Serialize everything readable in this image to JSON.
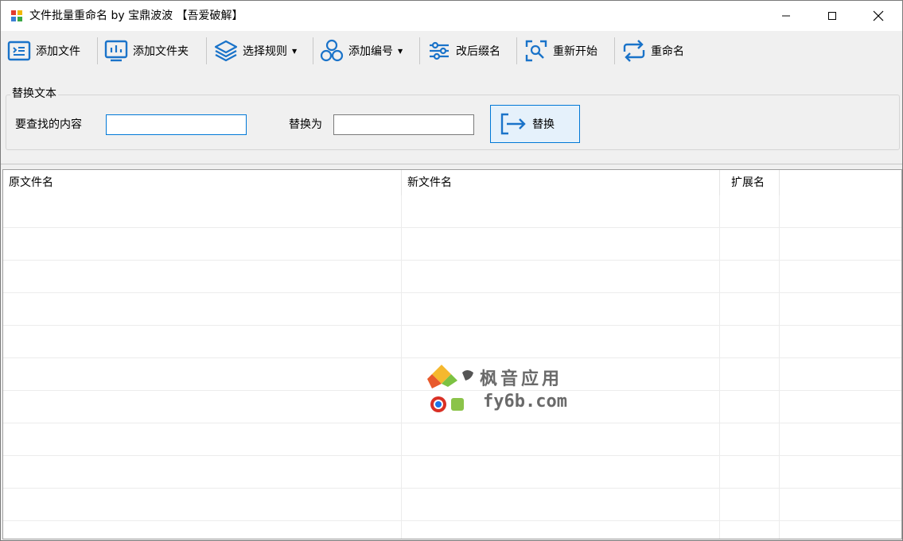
{
  "window": {
    "title": "文件批量重命名 by 宝鼎波波 【吾爱破解】"
  },
  "toolbar": {
    "items": [
      {
        "label": "添加文件",
        "icon": "add-file-icon"
      },
      {
        "label": "添加文件夹",
        "icon": "add-folder-icon"
      },
      {
        "label": "选择规则",
        "icon": "layers-icon",
        "dropdown": true
      },
      {
        "label": "添加编号",
        "icon": "hexagons-icon",
        "dropdown": true
      },
      {
        "label": "改后缀名",
        "icon": "sliders-icon"
      },
      {
        "label": "重新开始",
        "icon": "search-frame-icon"
      },
      {
        "label": "重命名",
        "icon": "repeat-icon"
      }
    ]
  },
  "replace_group": {
    "title": "替换文本",
    "find_label": "要查找的内容",
    "find_value": "",
    "replace_label": "替换为",
    "replace_value": "",
    "button_label": "替换"
  },
  "grid": {
    "columns": [
      "原文件名",
      "新文件名",
      "扩展名"
    ],
    "rows": []
  },
  "watermark": {
    "line1": "枫音应用",
    "line2": "fy6b.com"
  },
  "colors": {
    "accent": "#0078d7",
    "icon_blue": "#1a73c9"
  }
}
